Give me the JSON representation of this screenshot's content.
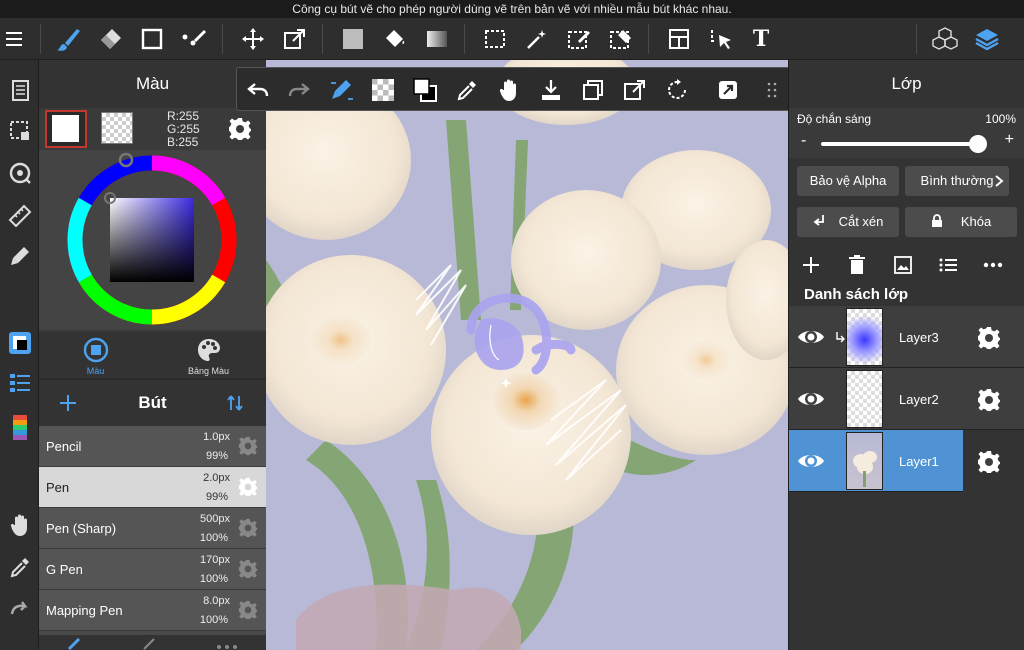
{
  "statusbar": {
    "tooltip": "Công cụ bút vẽ cho phép người dùng vẽ trên bản vẽ với nhiều mẫu bút khác nhau."
  },
  "toolbar": {
    "icons": [
      "menu-icon",
      "brush-icon",
      "eraser-icon",
      "shape-icon",
      "blend-icon",
      "move-icon",
      "transform-icon",
      "fill-color-icon",
      "bucket-icon",
      "gradient-icon",
      "select-icon",
      "magic-wand-icon",
      "select-pen-icon",
      "select-eraser-icon",
      "panel-layout-icon",
      "operation-icon",
      "text-icon",
      "3d-icon",
      "layers-icon"
    ],
    "text_tool_glyph": "T"
  },
  "color_panel": {
    "title": "Màu",
    "r": "R:255",
    "g": "G:255",
    "b": "B:255",
    "tab_color": "Màu",
    "tab_palette": "Bảng Màu",
    "primary_color": "#ffffff",
    "secondary_color": "#000000"
  },
  "brush_panel": {
    "title": "Bút",
    "brushes": [
      {
        "name": "Pencil",
        "size": "1.0px",
        "opacity": "99%"
      },
      {
        "name": "Pen",
        "size": "2.0px",
        "opacity": "99%"
      },
      {
        "name": "Pen (Sharp)",
        "size": "500px",
        "opacity": "100%"
      },
      {
        "name": "G Pen",
        "size": "170px",
        "opacity": "100%"
      },
      {
        "name": "Mapping Pen",
        "size": "8.0px",
        "opacity": "100%"
      }
    ],
    "selected": "Pen"
  },
  "layer_panel": {
    "title": "Lớp",
    "opacity_label": "Độ chắn sáng",
    "opacity_value": "100%",
    "opacity_level": 1.0,
    "alpha_protect": "Bảo vệ Alpha",
    "blend_mode": "Bình thường",
    "clipping": "Cắt xén",
    "lock": "Khóa",
    "list_title": "Danh sách lớp",
    "layers": [
      {
        "name": "Layer3"
      },
      {
        "name": "Layer2"
      },
      {
        "name": "Layer1"
      }
    ],
    "active_layer": "Layer1"
  },
  "colors": {
    "accent": "#4ea3f1",
    "active_layer": "#4f93d4",
    "canvas_bg": "#b7b9d6",
    "stroke_purple": "#a9a3f0"
  }
}
